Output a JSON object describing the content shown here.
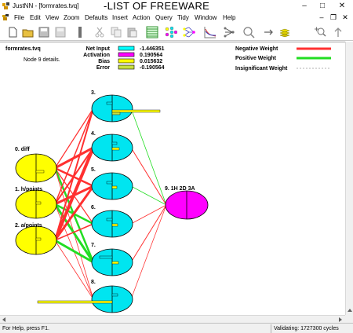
{
  "window": {
    "title": "JustNN - [formrates.tvq]",
    "watermark": "-LIST OF FREEWARE",
    "controls": {
      "minimize": "–",
      "maximize": "□",
      "close": "✕"
    }
  },
  "menu": {
    "items": [
      "File",
      "Edit",
      "View",
      "Zoom",
      "Defaults",
      "Insert",
      "Action",
      "Query",
      "Tidy",
      "Window",
      "Help"
    ],
    "mdi_controls": {
      "minimize": "–",
      "restore": "❐",
      "close": "✕"
    }
  },
  "toolbar": {
    "buttons": [
      "new-icon",
      "open-icon",
      "save-icon",
      "save-disabled-icon",
      "separator-bar-icon",
      "cut-icon",
      "copy-icon",
      "paste-icon",
      "grid-view-icon",
      "network-colors-icon",
      "network-links-icon",
      "learning-graph-icon",
      "prune-icon",
      "query-icon",
      "arrow-right-icon",
      "stack-icon",
      "add-query-icon",
      "up-arrow-icon"
    ]
  },
  "network": {
    "file_name": "formrates.tvq",
    "node_details": "Node 9 details.",
    "details": [
      {
        "label": "Net Input",
        "value": "-1.446351",
        "color": "#00ffff"
      },
      {
        "label": "Activation",
        "value": "0.190564",
        "color": "#ff00ff"
      },
      {
        "label": "Bias",
        "value": "0.015632",
        "color": "#ffff00"
      },
      {
        "label": "Error",
        "value": "-0.190564",
        "color": "#c8e040"
      }
    ],
    "legend": [
      {
        "label": "Negative Weight",
        "color": "#ff3030"
      },
      {
        "label": "Positive Weight",
        "color": "#22dd22"
      },
      {
        "label": "Insignificant Weight",
        "color": "#999999"
      }
    ],
    "input_nodes": [
      {
        "label": "0. diff"
      },
      {
        "label": "1. h/points"
      },
      {
        "label": "2. a/points"
      }
    ],
    "hidden_nodes": [
      "3.",
      "4.",
      "5.",
      "6.",
      "7.",
      "8."
    ],
    "output_node": {
      "label": "9. 1H 2D 3A"
    },
    "colors": {
      "input": "#ffff00",
      "hidden": "#00e5f0",
      "output": "#ff00ff"
    }
  },
  "status": {
    "help": "For Help, press F1.",
    "validating": "Validating:  1727300 cycles"
  }
}
